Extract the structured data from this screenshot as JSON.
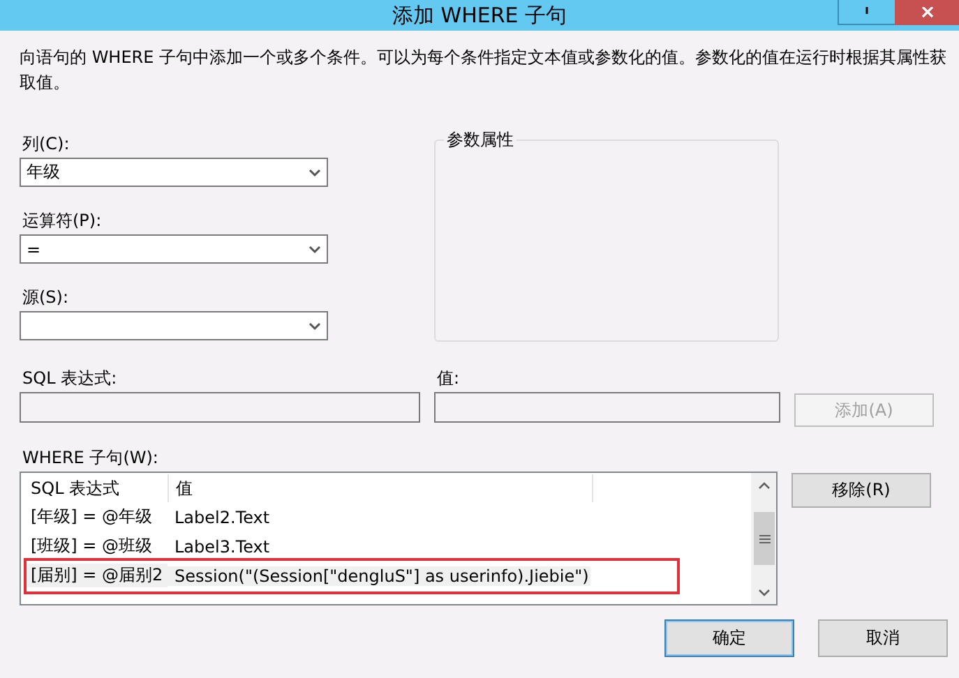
{
  "window": {
    "title": "添加 WHERE 子句"
  },
  "description": "向语句的 WHERE 子句中添加一个或多个条件。可以为每个条件指定文本值或参数化的值。参数化的值在运行时根据其属性获取值。",
  "fields": [
    {
      "label": "列(C):",
      "value": "年级"
    },
    {
      "label": "运算符(P):",
      "value": "="
    },
    {
      "label": "源(S):"
    }
  ],
  "parameter_properties": {
    "title": "参数属性"
  },
  "sql_expression": {
    "label": "SQL 表达式:"
  },
  "value": {
    "label": "值:"
  },
  "add_button": {
    "label": "添加(A)",
    "disabled": true
  },
  "where_clause": {
    "label": "WHERE 子句(W):",
    "columns": [
      "SQL 表达式",
      "值"
    ],
    "rows": [
      {
        "expression": "[年级] = @年级",
        "value": "Label2.Text",
        "selected": false,
        "highlighted": false
      },
      {
        "expression": "[班级] = @班级",
        "value": "Label3.Text",
        "selected": false,
        "highlighted": false
      },
      {
        "expression": "[届别] = @届别2",
        "value": "Session(\"(Session[\"dengluS\"] as userinfo).Jiebie\")",
        "selected": true,
        "highlighted": true
      }
    ]
  },
  "remove_button": {
    "label": "移除(R)"
  },
  "buttons": [
    {
      "label": "确定",
      "default": true
    },
    {
      "label": "取消",
      "default": false
    }
  ]
}
